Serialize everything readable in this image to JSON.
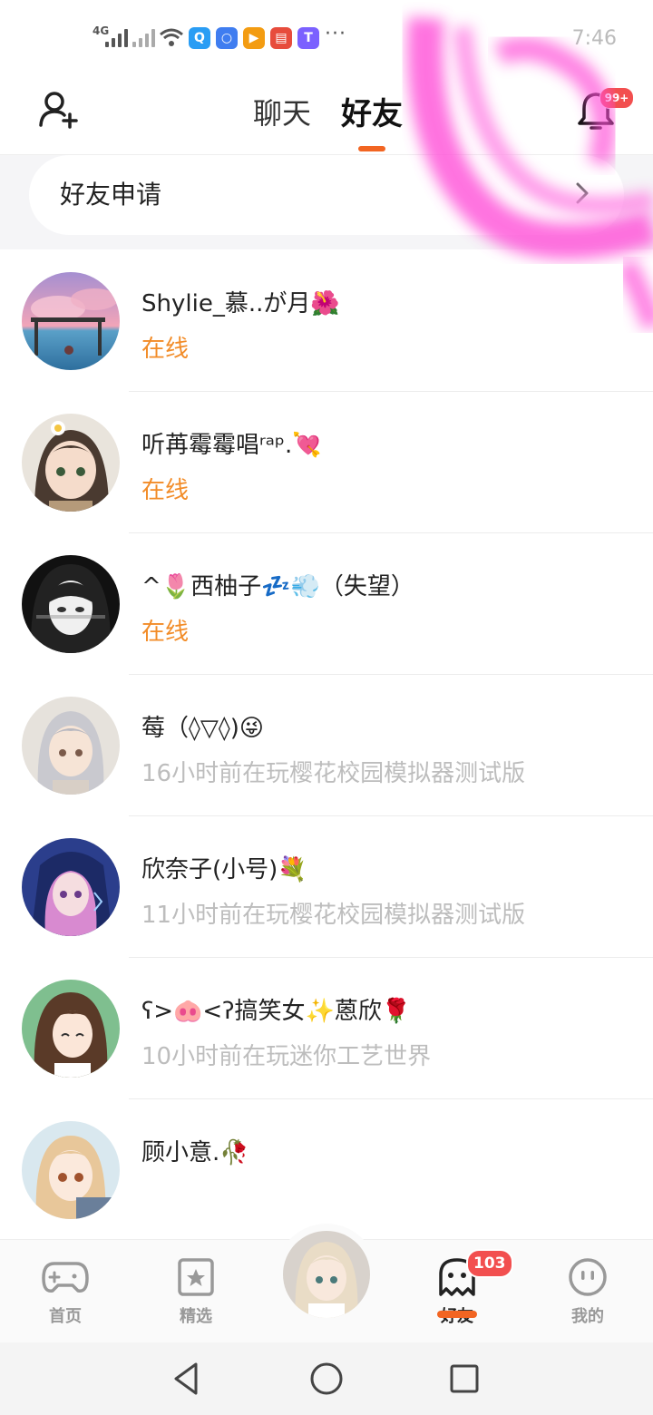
{
  "status_bar": {
    "network_label": "4G",
    "dots": "···",
    "time": "7:46",
    "app_icons": [
      {
        "icon": "search-app-icon",
        "color": "#2a9df4",
        "glyph": "Q"
      },
      {
        "icon": "bulb-app-icon",
        "color": "#3f7df0",
        "glyph": "💡"
      },
      {
        "icon": "play-app-icon",
        "color": "#f39c12",
        "glyph": "▶"
      },
      {
        "icon": "book-app-icon",
        "color": "#e74c3c",
        "glyph": "📖"
      },
      {
        "icon": "tag-app-icon",
        "color": "#7b61ff",
        "glyph": "T"
      }
    ]
  },
  "header": {
    "tab_chat": "聊天",
    "tab_friends": "好友",
    "notification_badge": "99+",
    "accent_color": "#f26522"
  },
  "friend_request": {
    "label": "好友申请"
  },
  "friends": [
    {
      "name": "Shylie_慕..が月🌺",
      "status": "在线",
      "online": true,
      "avatar": "sky-scene"
    },
    {
      "name": "听苒霉霉唱ʳᵃᵖ.💘",
      "status": "在线",
      "online": true,
      "avatar": "flower-girl"
    },
    {
      "name": "^🌷西柚子💤💨（失望）",
      "status": "在线",
      "online": true,
      "avatar": "monochrome-girl"
    },
    {
      "name": "莓（◊▽◊)😜",
      "status": "16小时前在玩樱花校园模拟器测试版",
      "online": false,
      "avatar": "silver-hair-girl"
    },
    {
      "name": "欣奈子(小号)💐",
      "status": "11小时前在玩樱花校园模拟器测试版",
      "online": false,
      "avatar": "purple-hair-girl"
    },
    {
      "name": "ʕ>🐽<ʔ搞笑女✨蒽欣🌹",
      "status": "10小时前在玩迷你工艺世界",
      "online": false,
      "avatar": "brown-hair-girl"
    },
    {
      "name": "顾小意.🥀",
      "status": "",
      "online": false,
      "avatar": "blonde-girl"
    }
  ],
  "bottom_nav": {
    "items": [
      {
        "label": "首页",
        "icon": "gamepad-icon"
      },
      {
        "label": "精选",
        "icon": "star-icon"
      },
      {
        "label": "好友",
        "icon": "ghost-icon",
        "badge": "103"
      },
      {
        "label": "我的",
        "icon": "face-icon"
      }
    ]
  },
  "colors": {
    "online": "#f28c28",
    "offline": "#bdbdbd",
    "badge": "#f24f4f"
  }
}
